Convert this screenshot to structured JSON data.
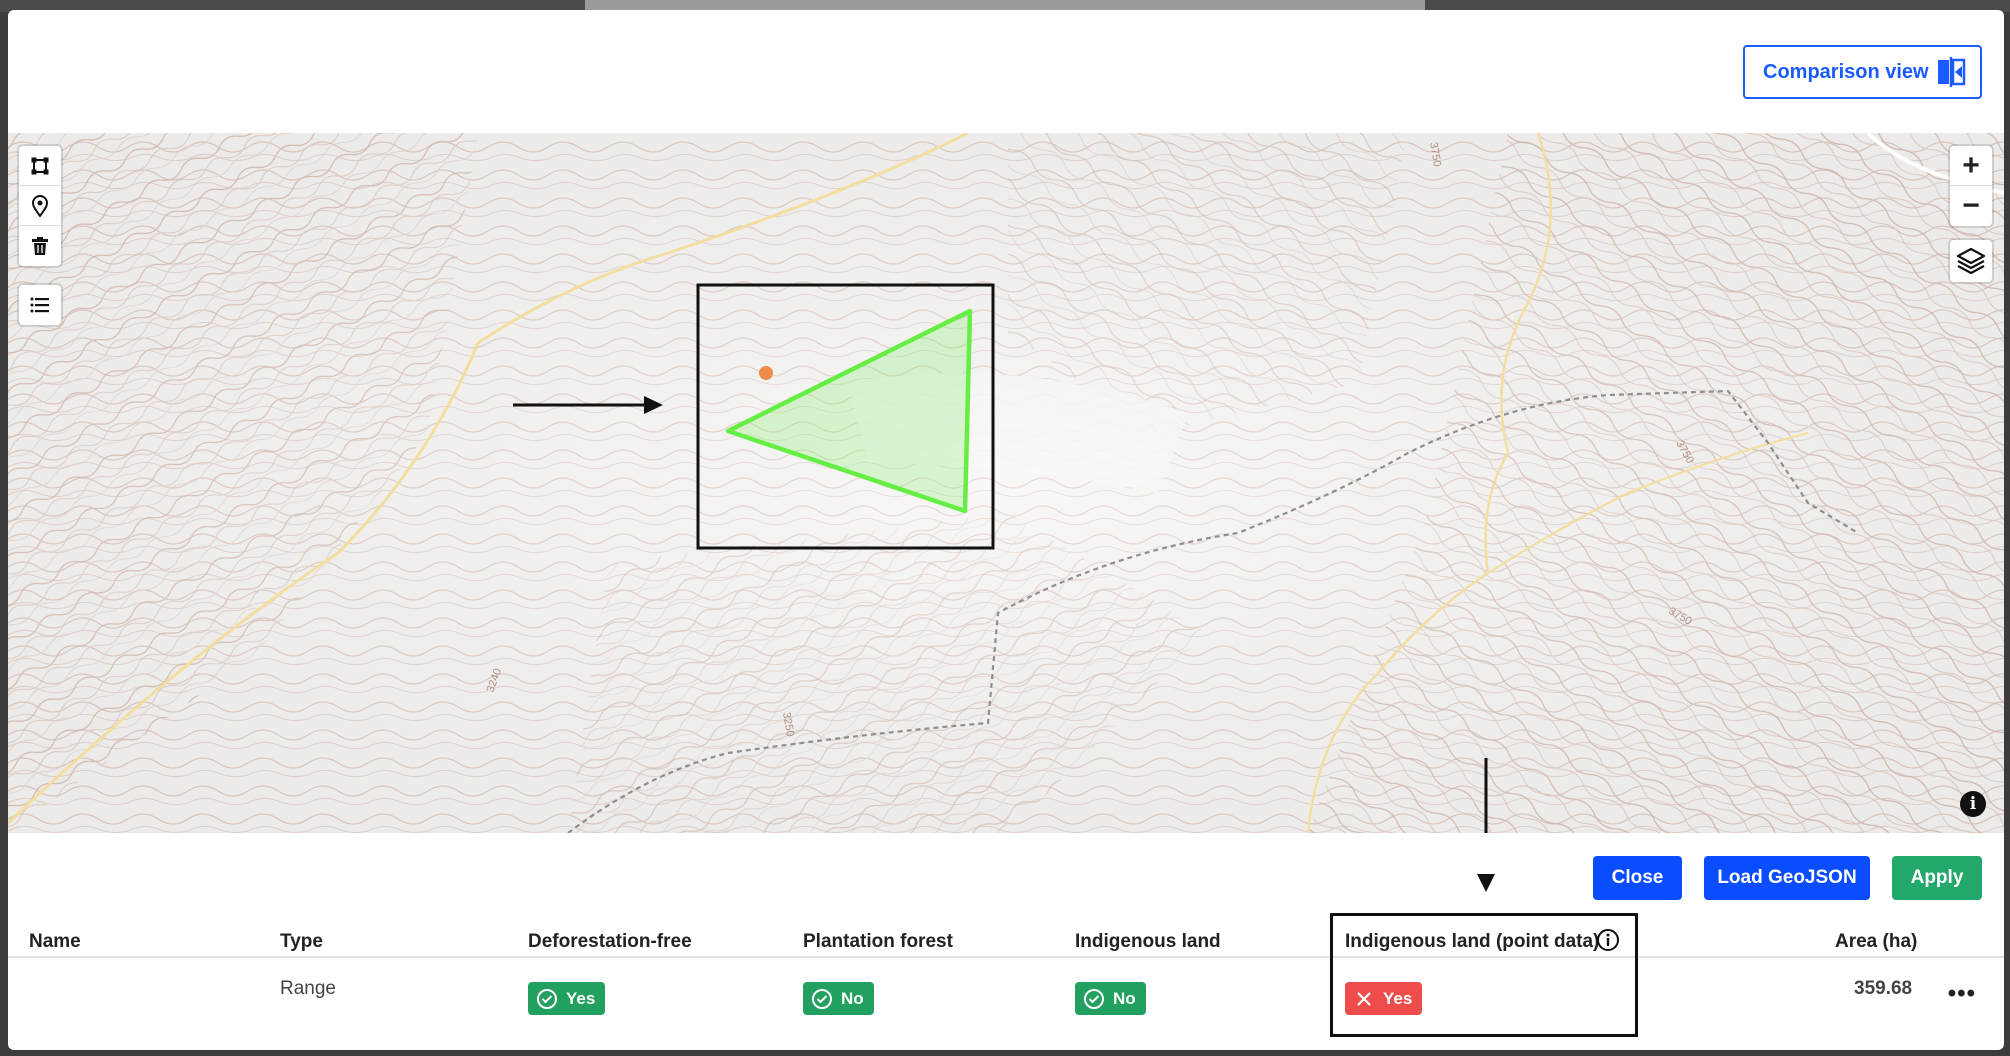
{
  "header": {
    "comparison_view_label": "Comparison view"
  },
  "map": {
    "tools": [
      {
        "icon": "draw-polygon-icon"
      },
      {
        "icon": "map-pin-icon"
      },
      {
        "icon": "trash-icon"
      },
      {
        "icon": "list-icon"
      }
    ],
    "zoom_in_label": "+",
    "zoom_out_label": "−",
    "info_label": "i",
    "contour_labels": [
      "3250",
      "3240",
      "3750",
      "3750",
      "3750"
    ],
    "polygon_color": "#66ee44",
    "point_color": "#ef8a4a"
  },
  "actions": {
    "close_label": "Close",
    "load_geojson_label": "Load GeoJSON",
    "apply_label": "Apply"
  },
  "table": {
    "headers": {
      "name": "Name",
      "type": "Type",
      "deforestation_free": "Deforestation-free",
      "plantation_forest": "Plantation forest",
      "indigenous_land": "Indigenous land",
      "indigenous_land_point": "Indigenous land (point data)",
      "area": "Area (ha)"
    },
    "rows": [
      {
        "name": "",
        "type": "Range",
        "deforestation_free": "Yes",
        "plantation_forest": "No",
        "indigenous_land": "No",
        "indigenous_land_point": "Yes",
        "area": "359.68",
        "more": "•••"
      }
    ]
  },
  "colors": {
    "primary_blue": "#0a4cff",
    "apply_green": "#22a86b",
    "badge_green": "#21a05f",
    "badge_red": "#ef4c4c",
    "contour": "#c4a394",
    "road": "#f3dea0"
  }
}
